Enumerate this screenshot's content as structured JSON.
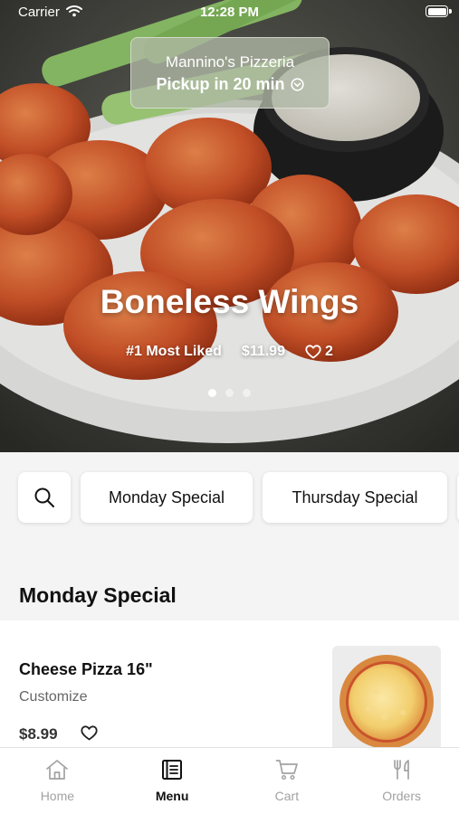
{
  "status_bar": {
    "carrier": "Carrier",
    "time": "12:28 PM"
  },
  "store": {
    "name": "Mannino's Pizzeria",
    "pickup": "Pickup in 20 min"
  },
  "hero": {
    "title": "Boneless Wings",
    "badge": "#1 Most Liked",
    "price": "$11.99",
    "likes": "2",
    "carousel": {
      "current": 1,
      "total": 3
    }
  },
  "categories": [
    "Monday Special",
    "Thursday Special"
  ],
  "section": {
    "title": "Monday Special"
  },
  "menu_item": {
    "name": "Cheese Pizza 16\"",
    "subtitle": "Customize",
    "price": "$8.99"
  },
  "tabs": [
    {
      "label": "Home",
      "icon": "home-icon",
      "active": false
    },
    {
      "label": "Menu",
      "icon": "menu-book-icon",
      "active": true
    },
    {
      "label": "Cart",
      "icon": "cart-icon",
      "active": false
    },
    {
      "label": "Orders",
      "icon": "fork-knife-icon",
      "active": false
    }
  ],
  "colors": {
    "active_tab": "#111111",
    "inactive_tab": "#a2a2a2",
    "wing_sauce": "#d2552a"
  }
}
